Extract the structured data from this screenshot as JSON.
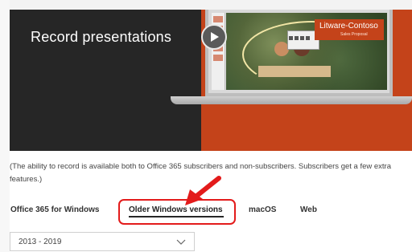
{
  "hero": {
    "title": "Record presentations",
    "slide_logo": "Litware-Contoso",
    "slide_logo_sub": "Sales Proposal",
    "play_icon": "play-icon",
    "colors": {
      "dark": "#262626",
      "accent": "#c4431a"
    }
  },
  "note": {
    "text": "(The ability to record is available both to Office 365 subscribers and non-subscribers. Subscribers get a few extra features.)"
  },
  "tabs": {
    "items": [
      {
        "label": "Office 365 for Windows",
        "selected": false
      },
      {
        "label": "Older Windows versions",
        "selected": true
      },
      {
        "label": "macOS",
        "selected": false
      },
      {
        "label": "Web",
        "selected": false
      }
    ],
    "highlight_color": "#e31b1b"
  },
  "version_select": {
    "value": "2013 - 2019",
    "icon": "chevron-down-icon"
  }
}
